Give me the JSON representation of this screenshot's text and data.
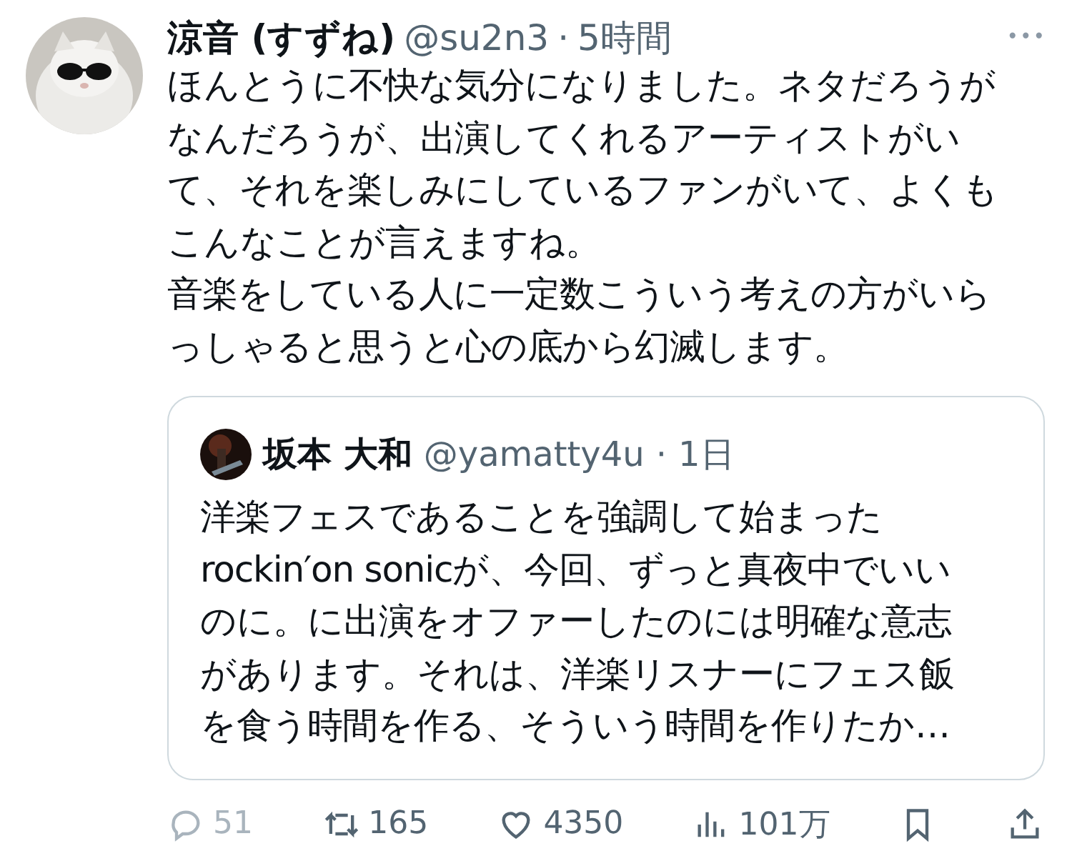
{
  "tweet": {
    "name": "涼音 (すずね)",
    "handle": "@su2n3",
    "separator": "·",
    "time": "5時間",
    "more": "•••",
    "lines": [
      "ほんとうに不快な気分になりました。ネタだろうが",
      "なんだろうが、出演してくれるアーティストがい",
      "て、それを楽しみにしているファンがいて、よくも",
      "こんなことが言えますね。",
      "音楽をしている人に一定数こういう考えの方がいら",
      "っしゃると思うと心の底から幻滅します。"
    ]
  },
  "quote": {
    "name": "坂本 大和",
    "handle": "@yamatty4u",
    "separator": "·",
    "time": "1日",
    "lines": [
      "洋楽フェスであることを強調して始まった",
      "rockin′on sonicが、今回、ずっと真夜中でいい",
      "のに。に出演をオファーしたのには明確な意志",
      "があります。それは、洋楽リスナーにフェス飯",
      "を食う時間を作る、そういう時間を作りたか…"
    ]
  },
  "actions": [
    {
      "kind": "reply",
      "count": "51",
      "disabled": true
    },
    {
      "kind": "repost",
      "count": "165",
      "disabled": false
    },
    {
      "kind": "like",
      "count": "4350",
      "disabled": false
    },
    {
      "kind": "views",
      "count": "101万",
      "disabled": false
    },
    {
      "kind": "bookmark",
      "disabled": false
    },
    {
      "kind": "share",
      "disabled": false
    }
  ]
}
